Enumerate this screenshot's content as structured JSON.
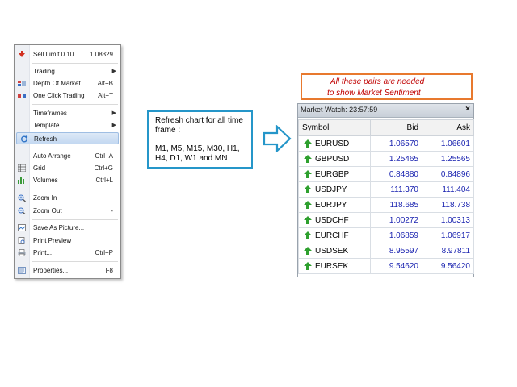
{
  "context_menu": {
    "items": [
      {
        "label": "Sell Limit 0.10",
        "shortcut": "1.08329",
        "icon": "sell-limit-icon"
      },
      {
        "label": "Trading",
        "shortcut": "",
        "submenu": true
      },
      {
        "label": "Depth Of Market",
        "shortcut": "Alt+B",
        "icon": "depth-of-market-icon"
      },
      {
        "label": "One Click Trading",
        "shortcut": "Alt+T",
        "icon": "one-click-trading-icon"
      },
      {
        "label": "Timeframes",
        "shortcut": "",
        "submenu": true
      },
      {
        "label": "Template",
        "shortcut": "",
        "submenu": true
      },
      {
        "label": "Refresh",
        "shortcut": "",
        "icon": "refresh-icon",
        "highlighted": true
      },
      {
        "label": "Auto Arrange",
        "shortcut": "Ctrl+A",
        "icon": "auto-arrange-icon"
      },
      {
        "label": "Grid",
        "shortcut": "Ctrl+G",
        "icon": "grid-icon"
      },
      {
        "label": "Volumes",
        "shortcut": "Ctrl+L",
        "icon": "volumes-icon"
      },
      {
        "label": "Zoom In",
        "shortcut": "+",
        "icon": "zoom-in-icon"
      },
      {
        "label": "Zoom Out",
        "shortcut": "-",
        "icon": "zoom-out-icon"
      },
      {
        "label": "Save As Picture...",
        "shortcut": "",
        "icon": "save-picture-icon"
      },
      {
        "label": "Print Preview",
        "shortcut": "",
        "icon": "print-preview-icon"
      },
      {
        "label": "Print...",
        "shortcut": "Ctrl+P",
        "icon": "print-icon"
      },
      {
        "label": "Properties...",
        "shortcut": "F8",
        "icon": "properties-icon"
      }
    ]
  },
  "callout": {
    "line1": "Refresh chart for all time",
    "line2": "frame :",
    "line3": "M1, M5, M15, M30, H1,",
    "line4": "H4, D1, W1 and MN"
  },
  "note": {
    "line1": "All these pairs are needed",
    "line2": "to show Market Sentiment"
  },
  "market_watch": {
    "title": "Market Watch: 23:57:59",
    "close": "×",
    "headers": {
      "symbol": "Symbol",
      "bid": "Bid",
      "ask": "Ask"
    },
    "rows": [
      {
        "symbol": "EURUSD",
        "bid": "1.06570",
        "ask": "1.06601"
      },
      {
        "symbol": "GBPUSD",
        "bid": "1.25465",
        "ask": "1.25565"
      },
      {
        "symbol": "EURGBP",
        "bid": "0.84880",
        "ask": "0.84896"
      },
      {
        "symbol": "USDJPY",
        "bid": "111.370",
        "ask": "111.404"
      },
      {
        "symbol": "EURJPY",
        "bid": "118.685",
        "ask": "118.738"
      },
      {
        "symbol": "USDCHF",
        "bid": "1.00272",
        "ask": "1.00313"
      },
      {
        "symbol": "EURCHF",
        "bid": "1.06859",
        "ask": "1.06917"
      },
      {
        "symbol": "USDSEK",
        "bid": "8.95597",
        "ask": "8.97811"
      },
      {
        "symbol": "EURSEK",
        "bid": "9.54620",
        "ask": "9.56420"
      }
    ]
  },
  "colors": {
    "callout_border": "#2596c9",
    "note_border": "#e8792e",
    "note_text": "#c00000",
    "price_text": "#1a23b0",
    "up_arrow": "#2ea02e"
  }
}
